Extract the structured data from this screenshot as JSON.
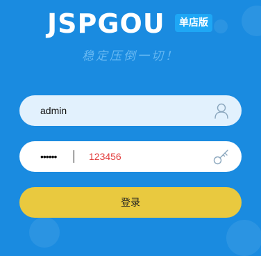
{
  "brand": {
    "logo_text": "JSPGOU",
    "badge": "单店版",
    "slogan": "稳定压倒一切！"
  },
  "login_form": {
    "username": {
      "value": "admin",
      "icon": "user-icon"
    },
    "password": {
      "masked_value": "••••••",
      "hint": "123456",
      "icon": "key-icon"
    },
    "submit_label": "登录"
  },
  "colors": {
    "background": "#1a8be0",
    "badge": "#1ea7f5",
    "button": "#e9c93f",
    "password_hint": "#e23b3b"
  }
}
